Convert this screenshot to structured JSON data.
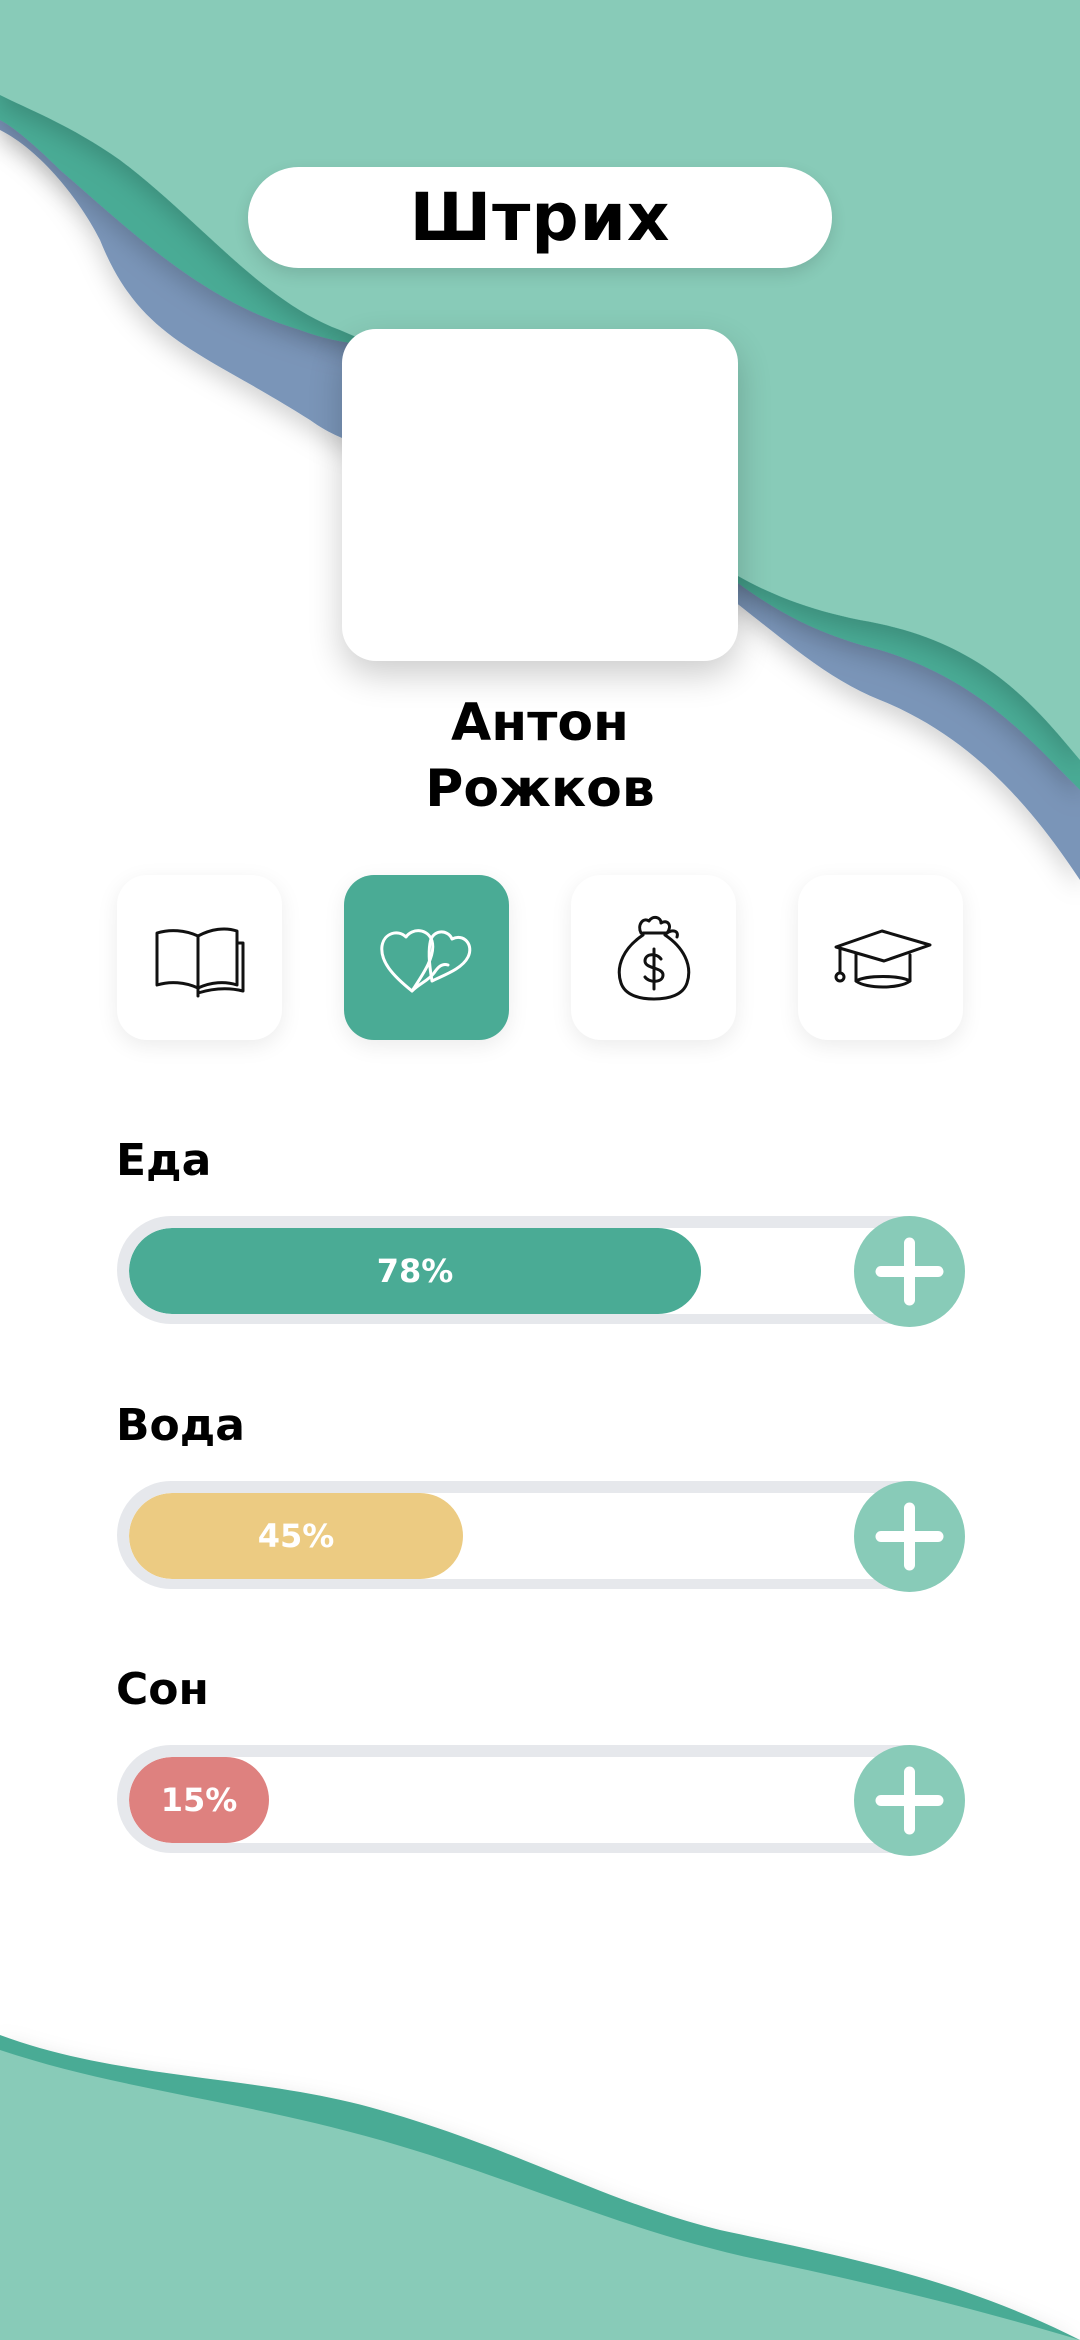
{
  "app": {
    "title": "Штрих"
  },
  "profile": {
    "first_name": "Антон",
    "last_name": "Рожков"
  },
  "categories": [
    {
      "icon": "book-icon",
      "active": false
    },
    {
      "icon": "hearts-icon",
      "active": true
    },
    {
      "icon": "money-bag-icon",
      "active": false
    },
    {
      "icon": "graduation-cap-icon",
      "active": false
    }
  ],
  "stats": [
    {
      "label": "Еда",
      "percent_label": "78%",
      "fraction": 0.78,
      "color": "#4aab95"
    },
    {
      "label": "Вода",
      "percent_label": "45%",
      "fraction": 0.45,
      "color": "#eccb82"
    },
    {
      "label": "Сон",
      "percent_label": "15%",
      "fraction": 0.15,
      "color": "#de817f"
    }
  ],
  "colors": {
    "wave_light": "#88cbb8",
    "wave_dark": "#4aab95",
    "wave_blue": "#7a95b8",
    "plus_button": "#88cbb8"
  }
}
